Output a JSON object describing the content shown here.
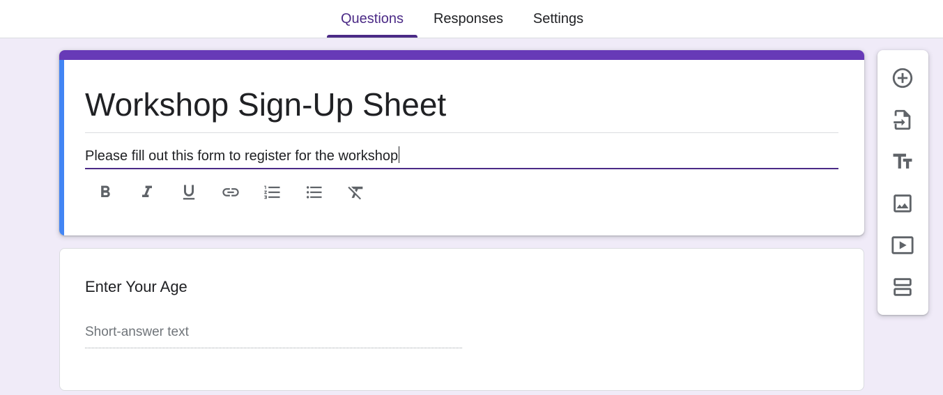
{
  "tabs": [
    {
      "label": "Questions",
      "active": true
    },
    {
      "label": "Responses",
      "active": false
    },
    {
      "label": "Settings",
      "active": false
    }
  ],
  "form": {
    "title": "Workshop Sign-Up Sheet",
    "description": "Please fill out this form to register for the workshop"
  },
  "format_toolbar": {
    "buttons": [
      "bold-icon",
      "italic-icon",
      "underline-icon",
      "link-icon",
      "numbered-list-icon",
      "bulleted-list-icon",
      "clear-formatting-icon"
    ]
  },
  "question": {
    "title": "Enter Your Age",
    "answer_placeholder": "Short-answer text"
  },
  "side_toolbar": {
    "buttons": [
      "add-question-icon",
      "import-questions-icon",
      "add-title-description-icon",
      "add-image-icon",
      "add-video-icon",
      "add-section-icon"
    ]
  },
  "colors": {
    "page_bg": "#f0ebf8",
    "accent": "#673ab7",
    "active_tab": "#4b2a86",
    "focus_strip": "#4285f4"
  }
}
